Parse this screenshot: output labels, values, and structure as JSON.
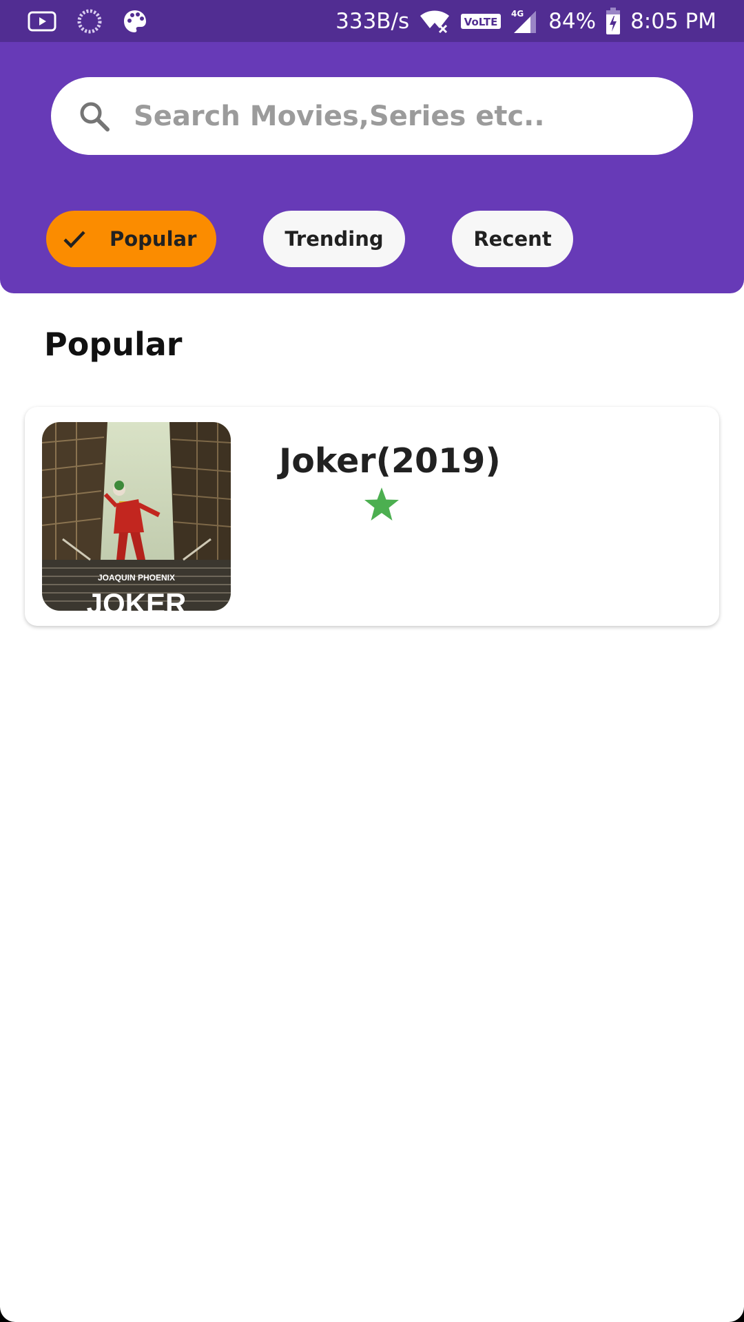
{
  "status_bar": {
    "net_speed": "333B/s",
    "volte": "VoLTE",
    "network": "4G",
    "battery": "84%",
    "time": "8:05 PM",
    "left_icons": [
      "youtube-icon",
      "loading-circle-icon",
      "palette-icon"
    ],
    "right_icons": [
      "wifi-off-icon",
      "volte-icon",
      "signal-icon",
      "battery-charging-icon"
    ]
  },
  "search": {
    "placeholder": "Search Movies,Series etc.."
  },
  "filters": [
    {
      "label": "Popular",
      "selected": true
    },
    {
      "label": "Trending",
      "selected": false
    },
    {
      "label": "Recent",
      "selected": false
    }
  ],
  "section": {
    "title": "Popular"
  },
  "movies": [
    {
      "title": "Joker(2019)",
      "poster_text_top": "JOAQUIN PHOENIX",
      "poster_text_bottom": "JOKER",
      "rating_stars": 1
    }
  ],
  "colors": {
    "header": "#673ab7",
    "status_bar": "#512d92",
    "chip_selected": "#fb8c00",
    "chip_unselected": "#f7f7f7",
    "star": "#4caf50"
  }
}
